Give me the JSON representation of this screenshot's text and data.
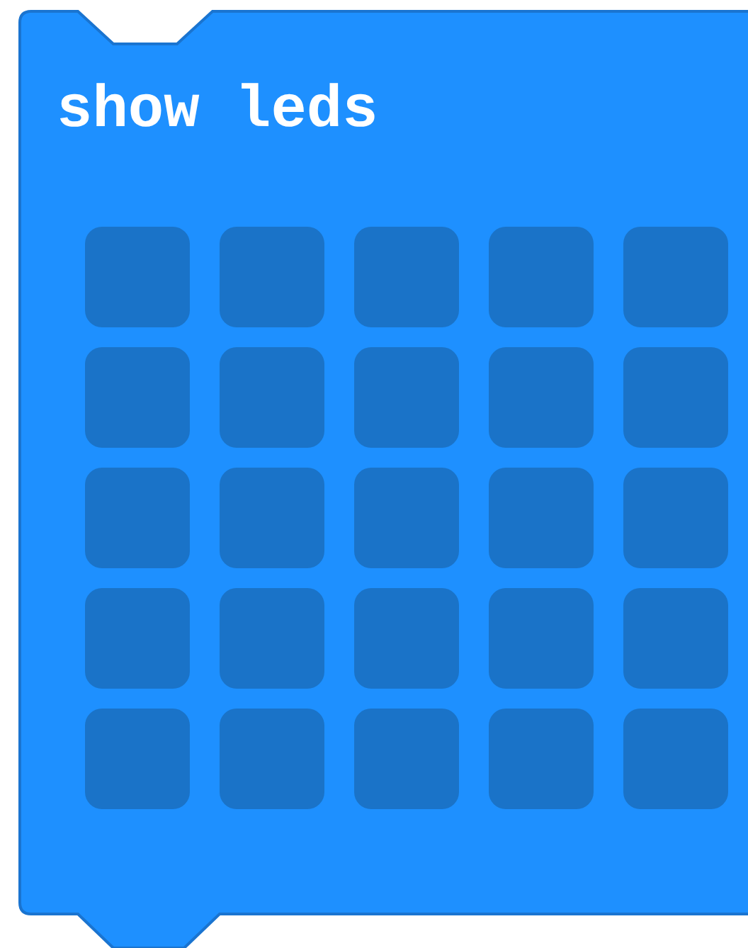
{
  "block": {
    "label": "show leds",
    "rows": [
      {
        "cells": [
          {
            "on": false
          },
          {
            "on": false
          },
          {
            "on": false
          },
          {
            "on": false
          },
          {
            "on": false
          }
        ]
      },
      {
        "cells": [
          {
            "on": false
          },
          {
            "on": false
          },
          {
            "on": false
          },
          {
            "on": false
          },
          {
            "on": false
          }
        ]
      },
      {
        "cells": [
          {
            "on": false
          },
          {
            "on": false
          },
          {
            "on": false
          },
          {
            "on": false
          },
          {
            "on": false
          }
        ]
      },
      {
        "cells": [
          {
            "on": false
          },
          {
            "on": false
          },
          {
            "on": false
          },
          {
            "on": false
          },
          {
            "on": false
          }
        ]
      },
      {
        "cells": [
          {
            "on": false
          },
          {
            "on": false
          },
          {
            "on": false
          },
          {
            "on": false
          },
          {
            "on": false
          }
        ]
      }
    ]
  }
}
